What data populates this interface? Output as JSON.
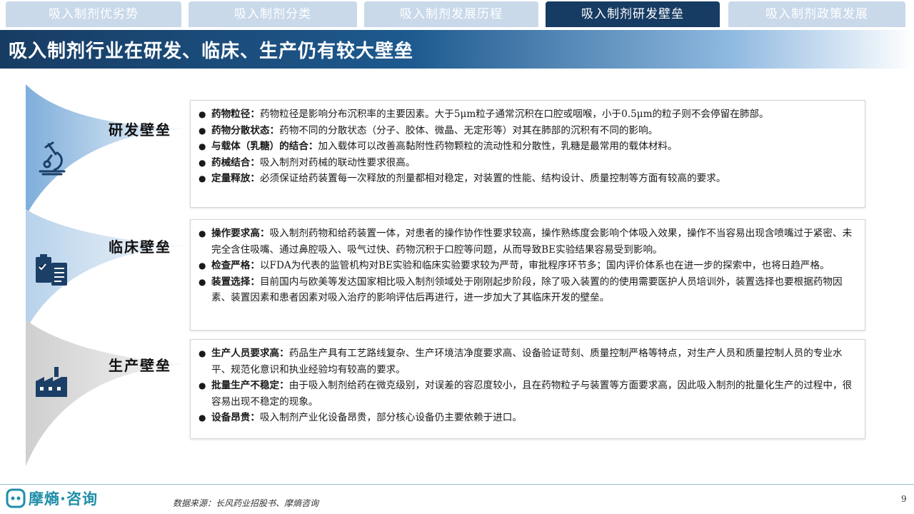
{
  "tabs": [
    {
      "label": "吸入制剂优劣势"
    },
    {
      "label": "吸入制剂分类"
    },
    {
      "label": "吸入制剂发展历程"
    },
    {
      "label": "吸入制剂研发壁垒"
    },
    {
      "label": "吸入制剂政策发展"
    }
  ],
  "title": "吸入制剂行业在研发、临床、生产仍有较大壁垒",
  "sections": [
    {
      "label": "研发壁垒",
      "icon": "microscope-icon",
      "items": [
        {
          "term": "药物粒径：",
          "text": "药物粒径是影响分布沉积率的主要因素。大于5μm粒子通常沉积在口腔或咽喉，小于0.5μm的粒子则不会停留在肺部。"
        },
        {
          "term": "药物分散状态：",
          "text": "药物不同的分散状态（分子、胶体、微晶、无定形等）对其在肺部的沉积有不同的影响。"
        },
        {
          "term": "与载体（乳糖）的结合：",
          "text": "加入载体可以改善高黏附性药物颗粒的流动性和分散性，乳糖是最常用的载体材料。"
        },
        {
          "term": "药械结合：",
          "text": "吸入制剂对药械的联动性要求很高。"
        },
        {
          "term": "定量释放：",
          "text": "必须保证给药装置每一次释放的剂量都相对稳定，对装置的性能、结构设计、质量控制等方面有较高的要求。"
        }
      ]
    },
    {
      "label": "临床壁垒",
      "icon": "clipboard-icon",
      "items": [
        {
          "term": "操作要求高：",
          "text": "吸入制剂药物和给药装置一体，对患者的操作协作性要求较高，操作熟练度会影响个体吸入效果，操作不当容易出现含喷嘴过于紧密、未完全含住吸嘴、通过鼻腔吸入、吸气过快、药物沉积于口腔等问题，从而导致BE实验结果容易受到影响。"
        },
        {
          "term": "检查严格：",
          "text": "以FDA为代表的监管机构对BE实验和临床实验要求较为严苛，审批程序环节多；国内评价体系也在进一步的探索中，也将日趋严格。"
        },
        {
          "term": "装置选择：",
          "text": "目前国内与欧美等发达国家相比吸入制剂领域处于刚刚起步阶段，除了吸入装置的的使用需要医护人员培训外，装置选择也要根据药物因素、装置因素和患者因素对吸入治疗的影响评估后再进行，进一步加大了其临床开发的壁垒。"
        }
      ]
    },
    {
      "label": "生产壁垒",
      "icon": "factory-icon",
      "items": [
        {
          "term": "生产人员要求高：",
          "text": "药品生产具有工艺路线复杂、生产环境洁净度要求高、设备验证苛刻、质量控制严格等特点，对生产人员和质量控制人员的专业水平、规范化意识和执业经验均有较高的要求。"
        },
        {
          "term": "批量生产不稳定：",
          "text": "由于吸入制剂给药在微克级别，对误差的容忍度较小，且在药物粒子与装置等方面要求高，因此吸入制剂的批量化生产的过程中，很容易出现不稳定的现象。"
        },
        {
          "term": "设备昂贵：",
          "text": "吸入制剂产业化设备昂贵，部分核心设备仍主要依赖于进口。"
        }
      ]
    }
  ],
  "footer": {
    "logo": "摩熵·咨询",
    "source": "数据来源：长风药业招股书、摩熵咨询",
    "page": "9"
  },
  "colors": {
    "navy": "#173c63",
    "tab_inactive": "#c9d9ea",
    "accent": "#1f8ea8"
  }
}
